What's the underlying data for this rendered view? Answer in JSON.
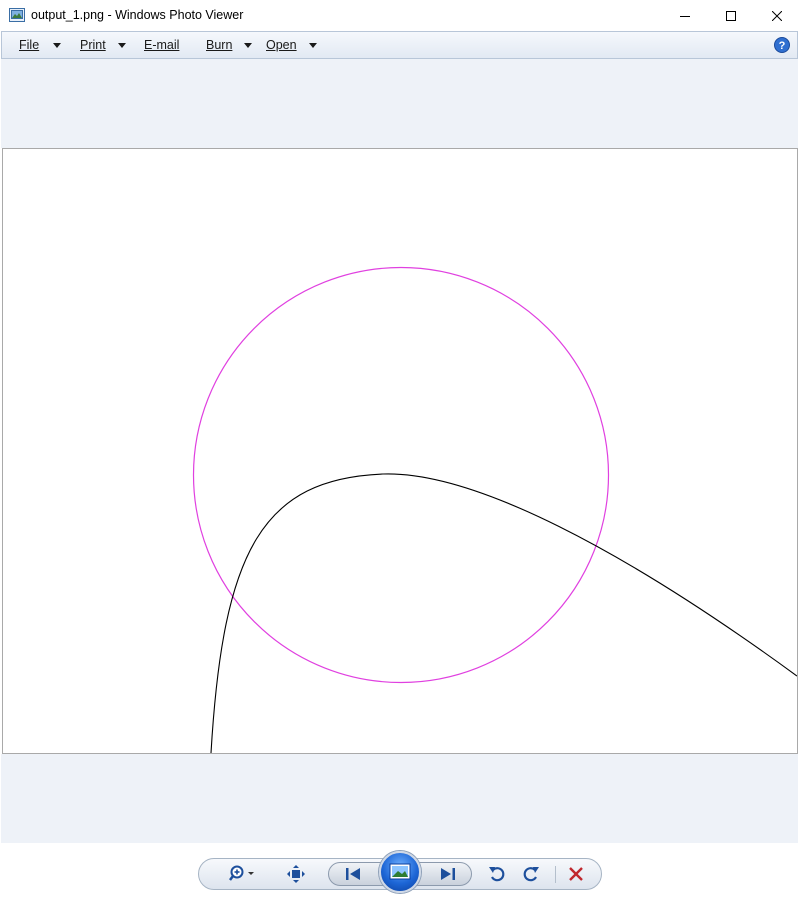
{
  "window": {
    "title": "output_1.png - Windows Photo Viewer"
  },
  "menu": {
    "items": [
      {
        "label": "File",
        "has_dropdown": true
      },
      {
        "label": "Print",
        "has_dropdown": true
      },
      {
        "label": "E-mail",
        "has_dropdown": false
      },
      {
        "label": "Burn",
        "has_dropdown": true
      },
      {
        "label": "Open",
        "has_dropdown": true
      }
    ],
    "help_icon": "help-icon"
  },
  "image": {
    "circle_color": "#e040e0",
    "curve_color": "#000000"
  },
  "toolbar": {
    "icons": [
      "zoom-icon",
      "actual-size-icon",
      "previous-icon",
      "slideshow-icon",
      "next-icon",
      "rotate-ccw-icon",
      "rotate-cw-icon",
      "delete-icon"
    ]
  },
  "colors": {
    "gutter": "#eef2f8",
    "menubar_border": "#b8c6d8",
    "accent_blue": "#1d66d6",
    "delete_red": "#c0272d"
  }
}
